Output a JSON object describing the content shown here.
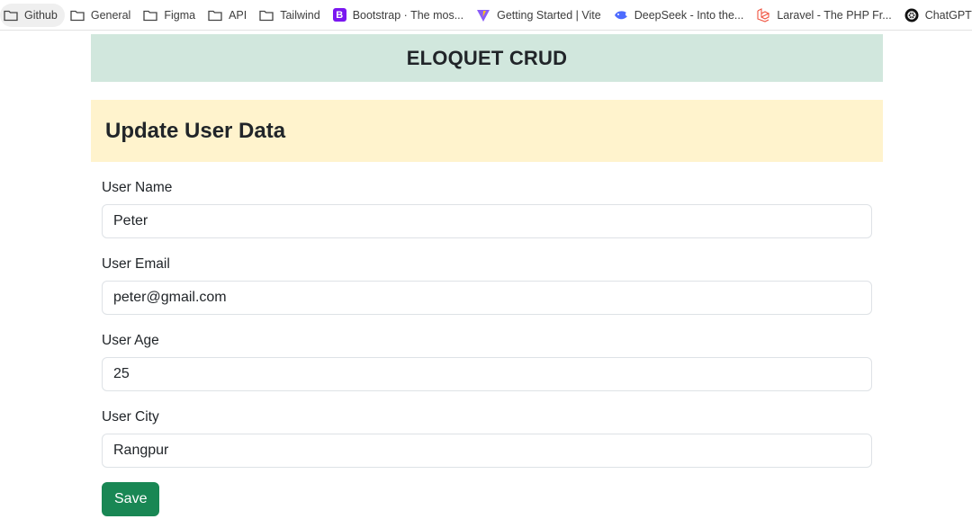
{
  "bookmarks": [
    {
      "label": "Github",
      "icon": "folder-icon"
    },
    {
      "label": "General",
      "icon": "folder-icon"
    },
    {
      "label": "Figma",
      "icon": "folder-icon"
    },
    {
      "label": "API",
      "icon": "folder-icon"
    },
    {
      "label": "Tailwind",
      "icon": "folder-icon"
    },
    {
      "label": "Bootstrap · The mos...",
      "icon": "bootstrap-icon"
    },
    {
      "label": "Getting Started | Vite",
      "icon": "vite-icon"
    },
    {
      "label": "DeepSeek - Into the...",
      "icon": "deepseek-icon"
    },
    {
      "label": "Laravel - The PHP Fr...",
      "icon": "laravel-icon"
    },
    {
      "label": "ChatGPT",
      "icon": "chatgpt-icon"
    }
  ],
  "app": {
    "title": "ELOQUET CRUD"
  },
  "card": {
    "title": "Update User Data"
  },
  "form": {
    "name_label": "User Name",
    "name_value": "Peter",
    "email_label": "User Email",
    "email_value": "peter@gmail.com",
    "age_label": "User Age",
    "age_value": "25",
    "city_label": "User City",
    "city_value": "Rangpur",
    "save_label": "Save"
  },
  "colors": {
    "header_bg": "#d1e7dd",
    "card_header_bg": "#fff3cd",
    "save_bg": "#198754"
  }
}
